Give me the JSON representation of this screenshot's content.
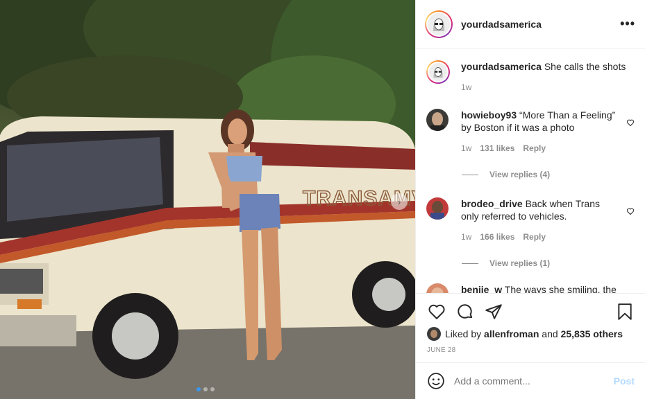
{
  "post": {
    "username": "yourdadsamerica",
    "more_label": "•••",
    "van_lettering": "TRANSAMVAN",
    "next_arrow": "›"
  },
  "caption": {
    "username": "yourdadsamerica",
    "text": "She calls the shots",
    "time": "1w"
  },
  "comments": [
    {
      "username": "howieboy93",
      "text": "“More Than a Feeling” by Boston if it was a photo",
      "time": "1w",
      "likes": "131 likes",
      "reply_label": "Reply",
      "view_replies": "View replies (4)"
    },
    {
      "username": "brodeo_drive",
      "text": "Back when Trans only referred to vehicles.",
      "time": "1w",
      "likes": "166 likes",
      "reply_label": "Reply",
      "view_replies": "View replies (1)"
    },
    {
      "username": "benjie_w",
      "text": "The ways she smiling, the"
    }
  ],
  "likes": {
    "prefix": "Liked by",
    "user": "allenfroman",
    "and": "and",
    "others": "25,835 others"
  },
  "date": "JUNE 28",
  "add_comment": {
    "placeholder": "Add a comment...",
    "post_label": "Post"
  },
  "carousel": {
    "index": 1,
    "count": 3
  },
  "colors": {
    "accent": "#3897f0",
    "post_disabled": "#b3dbff",
    "meta": "#8e8e8e"
  },
  "icons": [
    "more-icon",
    "heart-icon",
    "comment-icon",
    "share-icon",
    "bookmark-icon",
    "emoji-icon",
    "chevron-right-icon"
  ]
}
